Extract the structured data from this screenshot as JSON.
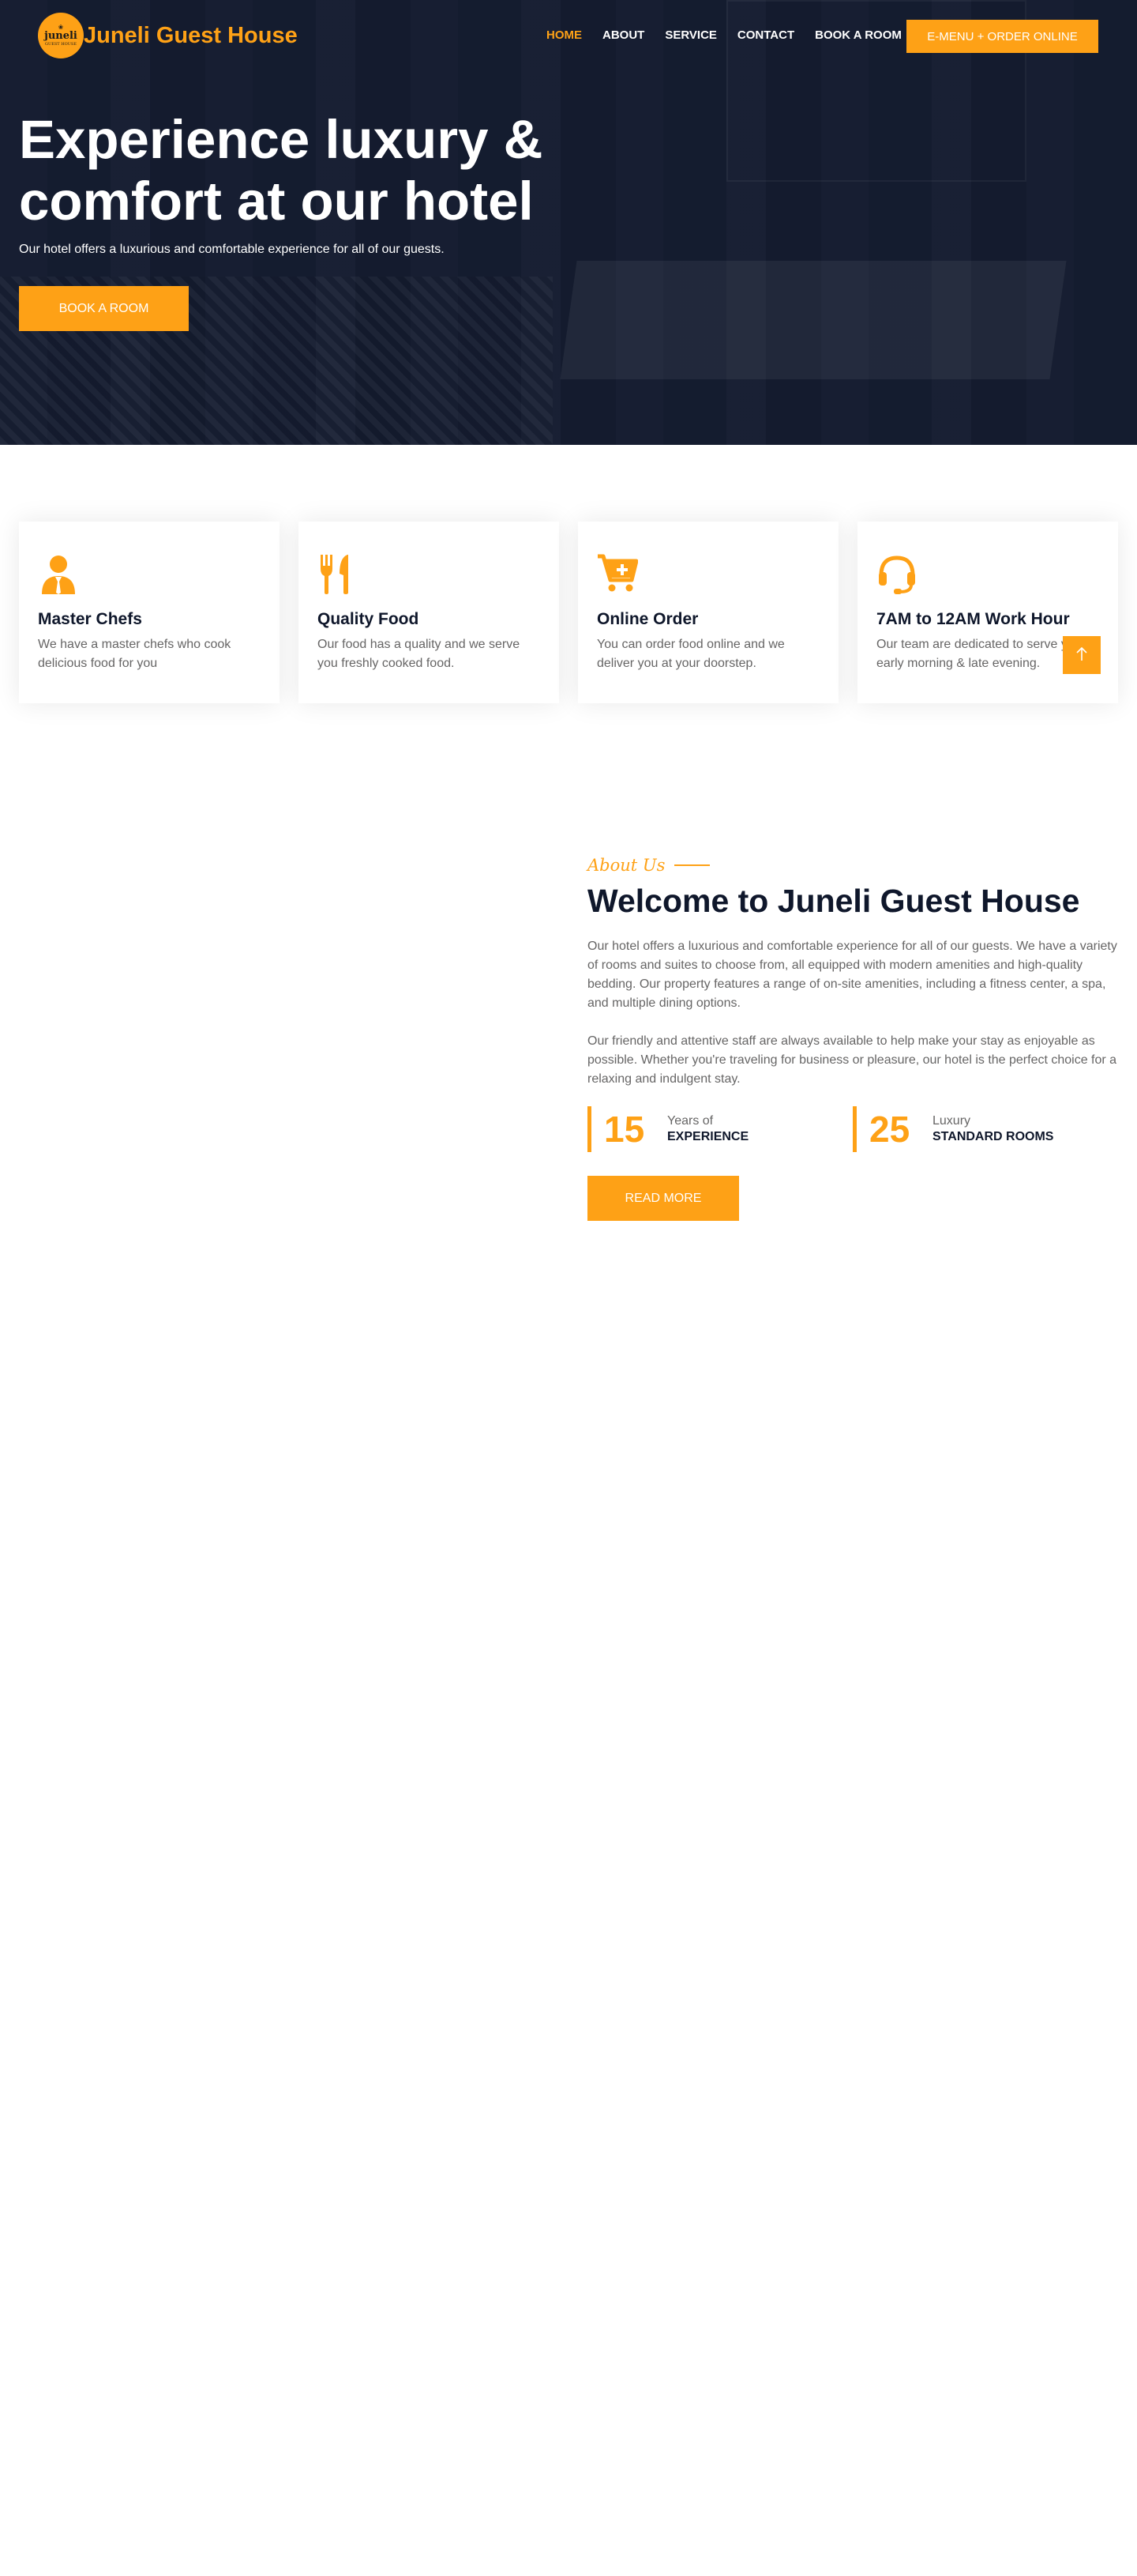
{
  "brand": {
    "logo_line1": "❀",
    "logo_line2": "juneli",
    "logo_line3": "GUEST HOUSE",
    "name": "Juneli Guest House"
  },
  "nav": {
    "items": [
      {
        "label": "HOME",
        "active": true
      },
      {
        "label": "ABOUT",
        "active": false
      },
      {
        "label": "SERVICE",
        "active": false
      },
      {
        "label": "CONTACT",
        "active": false
      },
      {
        "label": "BOOK A ROOM",
        "active": false
      }
    ],
    "cta_label": "E-MENU + ORDER ONLINE"
  },
  "hero": {
    "title": "Experience luxury & comfort at our hotel",
    "subtitle": "Our hotel offers a luxurious and comfortable experience for all of our guests.",
    "button_label": "BOOK A ROOM"
  },
  "services": [
    {
      "icon": "chef-icon",
      "title": "Master Chefs",
      "text": "We have a master chefs who cook delicious food for you"
    },
    {
      "icon": "utensils-icon",
      "title": "Quality Food",
      "text": "Our food has a quality and we serve you freshly cooked food."
    },
    {
      "icon": "cart-plus-icon",
      "title": "Online Order",
      "text": "You can order food online and we deliver you at your doorstep."
    },
    {
      "icon": "headset-icon",
      "title": "7AM to 12AM Work Hour",
      "text": "Our team are dedicated to serve you in early morning & late evening."
    }
  ],
  "back_to_top_icon": "arrow-up-icon",
  "about": {
    "subtitle": "About Us",
    "title": "Welcome to Juneli Guest House",
    "paragraph1": "Our hotel offers a luxurious and comfortable experience for all of our guests. We have a variety of rooms and suites to choose from, all equipped with modern amenities and high-quality bedding. Our property features a range of on-site amenities, including a fitness center, a spa, and multiple dining options.",
    "paragraph2": "Our friendly and attentive staff are always available to help make your stay as enjoyable as possible. Whether you're traveling for business or pleasure, our hotel is the perfect choice for a relaxing and indulgent stay.",
    "stats": [
      {
        "number": "15",
        "label1": "Years of",
        "label2": "EXPERIENCE"
      },
      {
        "number": "25",
        "label1": "Luxury",
        "label2": "STANDARD ROOMS"
      }
    ],
    "button_label": "READ MORE"
  },
  "colors": {
    "accent": "#fea116",
    "dark": "#0f172b",
    "text": "#666565"
  }
}
